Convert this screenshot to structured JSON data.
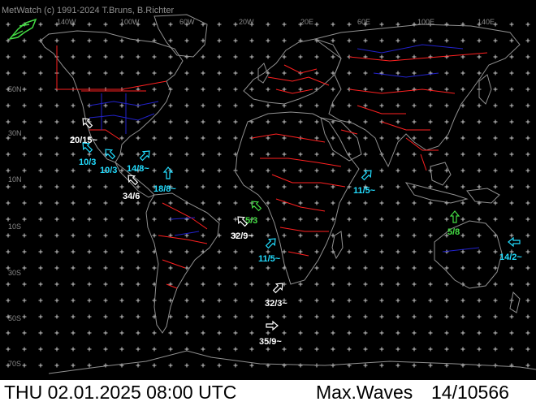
{
  "header": {
    "copyright": "MetWatch  (c) 1991-2024 T.Bruns, B.Richter"
  },
  "colors": {
    "background": "#000000",
    "coastline": "#909090",
    "country_border": "#ff2020",
    "state_border": "#2222cc",
    "grid_cross": "#c8c8c8",
    "label_white": "#ffffff",
    "label_cyan": "#22ddff",
    "label_green": "#44dd44",
    "status_bg": "#ffffff",
    "status_fg": "#000000"
  },
  "longitude_labels": [
    "140W",
    "100W",
    "60W",
    "20W",
    "20E",
    "60E",
    "100E",
    "140E"
  ],
  "latitude_labels": [
    "50N",
    "30N",
    "10N",
    "10S",
    "30S",
    "50S",
    "70S"
  ],
  "wave_reports": [
    {
      "text": "20/15~",
      "color": "white",
      "arrow_dir": "NW"
    },
    {
      "text": "10/3",
      "color": "cyan",
      "arrow_dir": "NW"
    },
    {
      "text": "10/3",
      "color": "cyan",
      "arrow_dir": "NW"
    },
    {
      "text": "14/8~",
      "color": "cyan",
      "arrow_dir": "NE"
    },
    {
      "text": "18/8~",
      "color": "cyan",
      "arrow_dir": "N"
    },
    {
      "text": "34/6",
      "color": "white",
      "arrow_dir": "NW"
    },
    {
      "text": "5/3",
      "color": "green",
      "arrow_dir": "NW"
    },
    {
      "text": "32/9~",
      "color": "white",
      "arrow_dir": "NW"
    },
    {
      "text": "11/5~",
      "color": "cyan",
      "arrow_dir": "NE"
    },
    {
      "text": "32/3~",
      "color": "white",
      "arrow_dir": "NE"
    },
    {
      "text": "35/9~",
      "color": "white",
      "arrow_dir": "E"
    },
    {
      "text": "11/5~",
      "color": "cyan",
      "arrow_dir": "NE"
    },
    {
      "text": "5/8",
      "color": "green",
      "arrow_dir": "N"
    },
    {
      "text": "14/2~",
      "color": "cyan",
      "arrow_dir": "W"
    }
  ],
  "status": {
    "datetime": "THU 02.01.2025 08:00 UTC",
    "product": "Max.Waves",
    "code": "14/10566"
  }
}
